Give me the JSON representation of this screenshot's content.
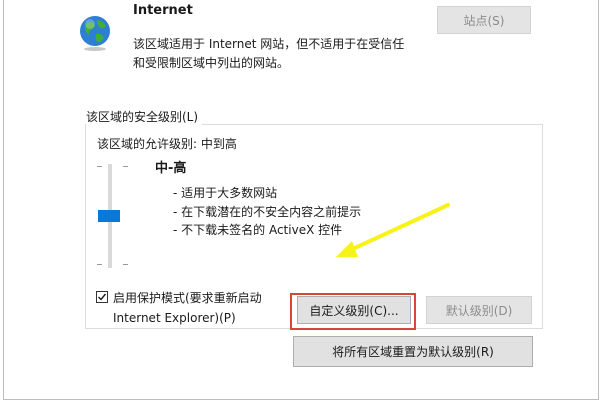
{
  "zone": {
    "title": "Internet",
    "description_line1": "该区域适用于 Internet 网站，但不适用于在受信任",
    "description_line2": "和受限制区域中列出的网站。",
    "sites_button": "站点(S)"
  },
  "security": {
    "group_label": "该区域的安全级别(L)",
    "allowed_levels": "该区域的允许级别: 中到高",
    "level_name": "中-高",
    "bullets": [
      "- 适用于大多数网站",
      "- 在下载潜在的不安全内容之前提示",
      "- 不下载未签名的 ActiveX 控件"
    ],
    "slider_level": 0.5,
    "protected_mode": {
      "checked": true,
      "label_line1": "启用保护模式(要求重新启动",
      "label_line2": "Internet Explorer)(P)"
    },
    "custom_level_button": "自定义级别(C)...",
    "default_level_button": "默认级别(D)",
    "reset_all_button": "将所有区域重置为默认级别(R)"
  },
  "colors": {
    "slider_thumb": "#0a78d7",
    "highlight_box": "#d9453a",
    "annotation_arrow": "#f7f21a"
  }
}
